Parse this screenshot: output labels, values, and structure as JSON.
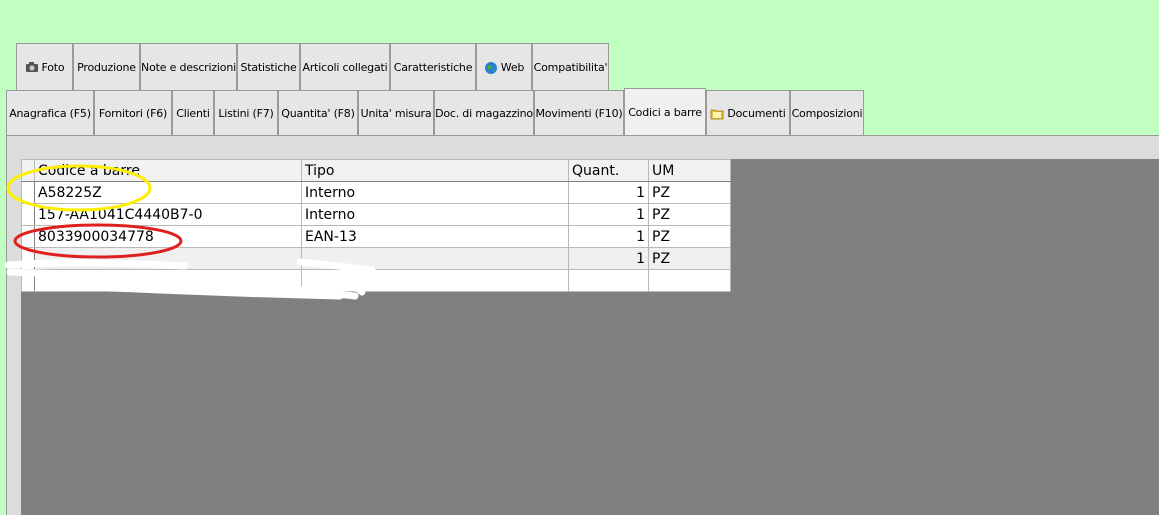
{
  "tabs_row1": [
    {
      "label": "Foto",
      "icon": "camera-icon"
    },
    {
      "label": "Produzione"
    },
    {
      "label": "Note e descrizioni"
    },
    {
      "label": "Statistiche"
    },
    {
      "label": "Articoli collegati"
    },
    {
      "label": "Caratteristiche"
    },
    {
      "label": "Web",
      "icon": "globe-icon"
    },
    {
      "label": "Compatibilita'"
    }
  ],
  "tabs_row2": [
    {
      "label": "Anagrafica (F5)"
    },
    {
      "label": "Fornitori (F6)"
    },
    {
      "label": "Clienti"
    },
    {
      "label": "Listini (F7)"
    },
    {
      "label": "Quantita' (F8)"
    },
    {
      "label": "Unita' misura"
    },
    {
      "label": "Doc. di magazzino"
    },
    {
      "label": "Movimenti (F10)"
    },
    {
      "label": "Codici a barre",
      "active": true
    },
    {
      "label": "Documenti",
      "icon": "folder-icon"
    },
    {
      "label": "Composizioni"
    }
  ],
  "barcode_table": {
    "columns": [
      "Codice a barre",
      "Tipo",
      "Quant.",
      "UM"
    ],
    "rows": [
      {
        "code": "A58225Z",
        "type": "Interno",
        "qty": "1",
        "um": "PZ"
      },
      {
        "code": "157-AA1041C4440B7-0",
        "type": "Interno",
        "qty": "1",
        "um": "PZ"
      },
      {
        "code": "8033900034778",
        "type": "EAN-13",
        "qty": "1",
        "um": "PZ"
      },
      {
        "code": "",
        "type": "",
        "qty": "1",
        "um": "PZ"
      },
      {
        "code": "",
        "type": "",
        "qty": "",
        "um": ""
      }
    ]
  },
  "colors": {
    "background": "#c0ffc0",
    "highlight_yellow": "#ffee00",
    "highlight_red": "#e02020"
  }
}
